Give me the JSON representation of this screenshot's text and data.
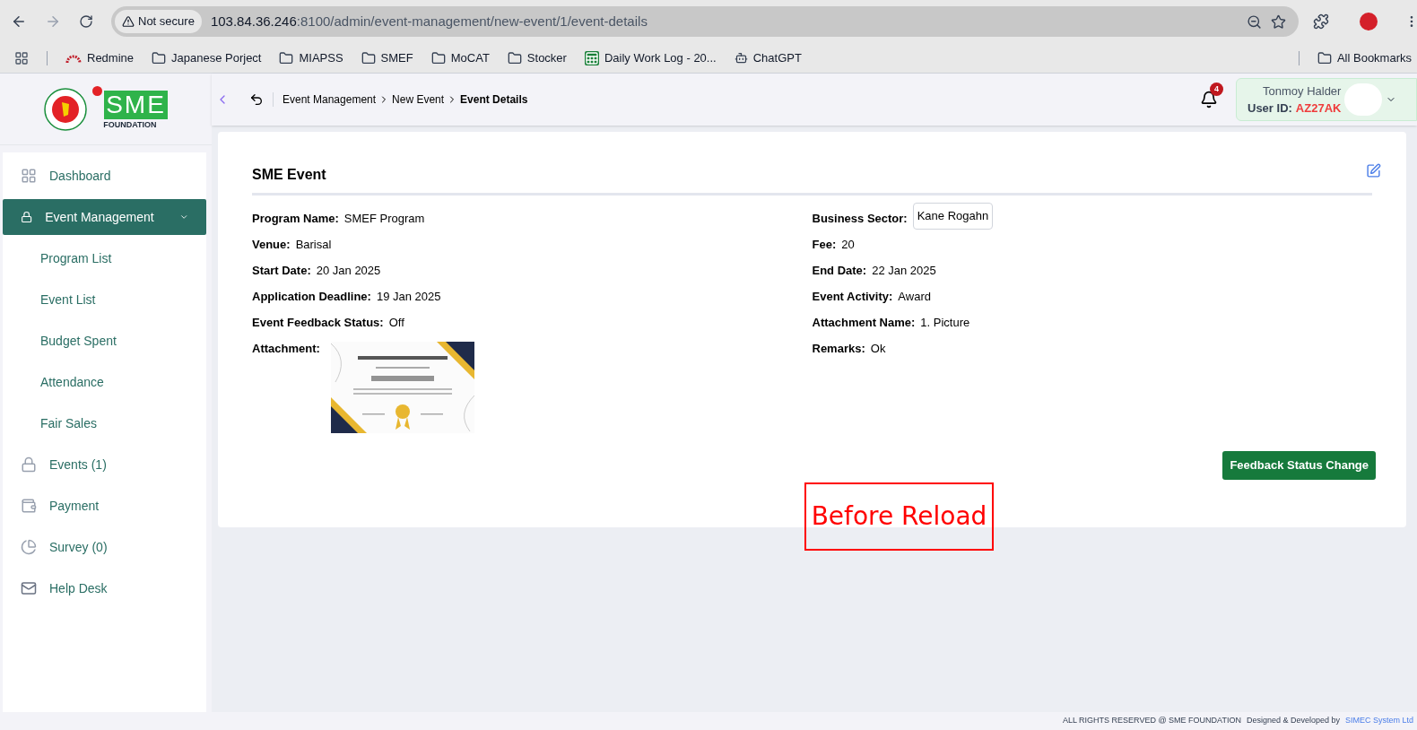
{
  "browser": {
    "security": "Not secure",
    "url_host": "103.84.36.246",
    "url_rest": ":8100/admin/event-management/new-event/1/event-details",
    "bookmarks": [
      {
        "kind": "redmine",
        "label": "Redmine"
      },
      {
        "kind": "folder",
        "label": "Japanese Porject"
      },
      {
        "kind": "folder",
        "label": "MIAPSS"
      },
      {
        "kind": "folder",
        "label": "SMEF"
      },
      {
        "kind": "folder",
        "label": "MoCAT"
      },
      {
        "kind": "folder",
        "label": "Stocker"
      },
      {
        "kind": "sheet",
        "label": "Daily Work Log - 20..."
      },
      {
        "kind": "chat",
        "label": "ChatGPT"
      }
    ],
    "all_bookmarks": "All Bookmarks"
  },
  "logo": {
    "mark": "SME",
    "subtitle": "FOUNDATION"
  },
  "sidebar": {
    "items": [
      {
        "label": "Dashboard",
        "selected": false
      },
      {
        "label": "Event Management",
        "selected": true,
        "expanded": true,
        "children": [
          {
            "label": "Program List",
            "selected": false
          },
          {
            "label": "Event List",
            "selected": false
          },
          {
            "label": "Budget Spent",
            "selected": false
          },
          {
            "label": "Attendance",
            "selected": false
          },
          {
            "label": "Fair Sales",
            "selected": false
          }
        ]
      },
      {
        "label": "Events (1)",
        "selected": false
      },
      {
        "label": "Payment",
        "selected": false
      },
      {
        "label": "Survey (0)",
        "selected": false
      },
      {
        "label": "Help Desk",
        "selected": false
      }
    ]
  },
  "header": {
    "breadcrumbs": [
      "Event Management",
      "New Event",
      "Event Details"
    ],
    "notifications": "4",
    "user_name": "Tonmoy Halder",
    "user_id_label": "User ID:",
    "user_id": "AZ27AK"
  },
  "card": {
    "title": "SME Event",
    "left_fields": [
      {
        "kind": "text",
        "label": "Program Name:",
        "value": "SMEF Program"
      },
      {
        "kind": "text",
        "label": "Venue:",
        "value": "Barisal"
      },
      {
        "kind": "text",
        "label": "Start Date:",
        "value": "20 Jan 2025"
      },
      {
        "kind": "text",
        "label": "Application Deadline:",
        "value": "19 Jan 2025"
      },
      {
        "kind": "text",
        "label": "Event Feedback Status:",
        "value": "Off"
      },
      {
        "kind": "picture",
        "label": "Attachment:"
      }
    ],
    "right_fields": [
      {
        "kind": "tag",
        "label": "Business Sector:",
        "value": "Kane Rogahn"
      },
      {
        "kind": "text",
        "label": "Fee:",
        "value": "20"
      },
      {
        "kind": "text",
        "label": "End Date:",
        "value": "22 Jan 2025"
      },
      {
        "kind": "text",
        "label": "Event Activity:",
        "value": "Award"
      },
      {
        "kind": "text",
        "label": "Attachment Name:",
        "value": "1. Picture"
      },
      {
        "kind": "text",
        "label": "Remarks:",
        "value": "Ok"
      }
    ],
    "button": "Feedback Status Change"
  },
  "annotation": "Before Reload",
  "footer": {
    "rights": "ALL RIGHTS RESERVED @ SME FOUNDATION",
    "designed_by": "Designed & Developed by",
    "company": "SIMEC System Ltd"
  }
}
